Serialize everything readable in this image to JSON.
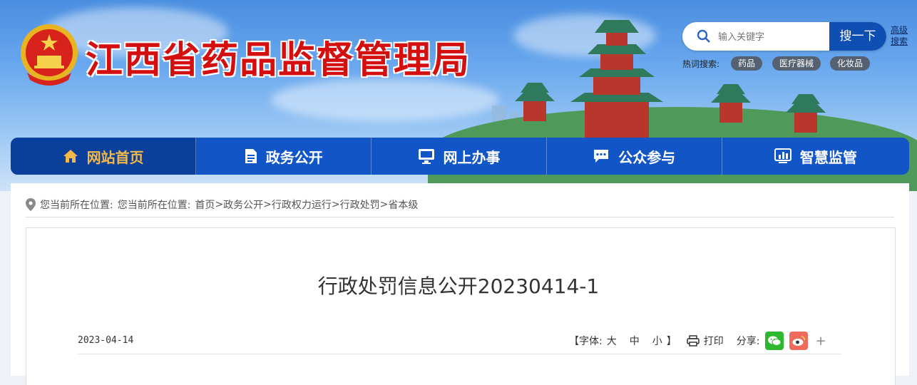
{
  "header": {
    "site_title": "江西省药品监督管理局",
    "search": {
      "placeholder": "输入关键字",
      "button_label": "搜一下",
      "advanced_label": "高级搜索"
    },
    "hot_search": {
      "label": "热词搜索:",
      "tags": [
        "药品",
        "医疗器械",
        "化妆品"
      ]
    }
  },
  "nav": {
    "items": [
      {
        "label": "网站首页",
        "icon": "home-icon",
        "active": true
      },
      {
        "label": "政务公开",
        "icon": "document-icon",
        "active": false
      },
      {
        "label": "网上办事",
        "icon": "monitor-icon",
        "active": false
      },
      {
        "label": "公众参与",
        "icon": "chat-icon",
        "active": false
      },
      {
        "label": "智慧监管",
        "icon": "dashboard-icon",
        "active": false
      }
    ]
  },
  "breadcrumb": {
    "prefix": "您当前所在位置:",
    "prefix2": "您当前所在位置:",
    "path": [
      "首页",
      "政务公开",
      "行政权力运行",
      "行政处罚",
      "省本级"
    ],
    "separator": ">"
  },
  "article": {
    "title": "行政处罚信息公开20230414-1",
    "date": "2023-04-14",
    "font_size_label": "【字体:",
    "font_large": "大",
    "font_medium": "中",
    "font_small": "小",
    "font_close": "】",
    "print_label": "打印",
    "share_label": "分享:",
    "share_more": "+"
  },
  "colors": {
    "nav_bg": "#1155c7",
    "nav_active_bg": "#0b3f9c",
    "nav_active_text": "#f3b84a",
    "title_red": "#d40f10",
    "search_btn": "#0f4fb4"
  }
}
